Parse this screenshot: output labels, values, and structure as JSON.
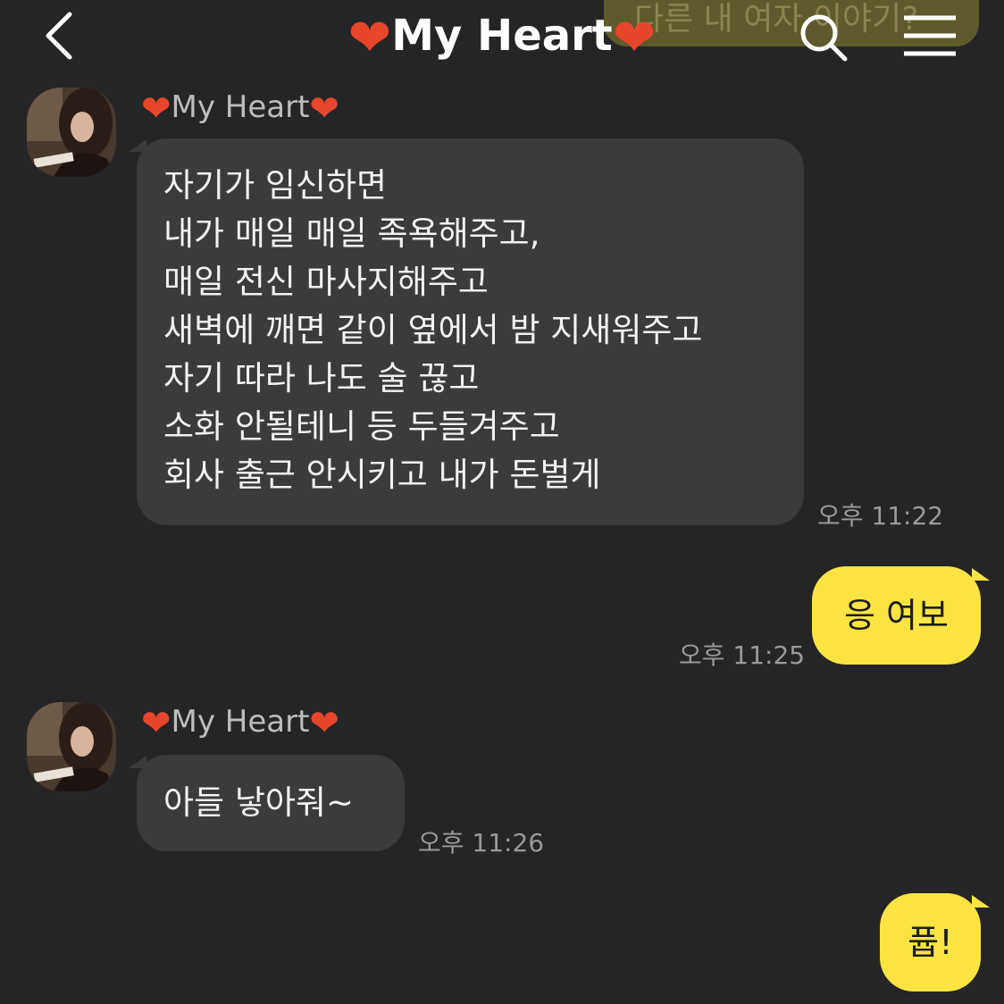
{
  "header": {
    "title": "My Heart",
    "background_bubble_text": "다른 내 여자 이야기?"
  },
  "colors": {
    "background": "#252527",
    "incoming_bubble": "#3b3b3d",
    "outgoing_bubble": "#fde443",
    "heart": "#e8462a"
  },
  "icons": {
    "back": "chevron-left-icon",
    "search": "search-icon",
    "menu": "hamburger-menu-icon",
    "heart": "heart-icon"
  },
  "messages": [
    {
      "direction": "incoming",
      "sender": "My Heart",
      "lines": [
        "자기가 임신하면",
        "내가 매일 매일 족욕해주고,",
        "매일 전신 마사지해주고",
        "새벽에 깨면 같이 옆에서 밤 지새워주고",
        "자기 따라 나도 술 끊고",
        "소화 안될테니 등 두들겨주고",
        "회사 출근 안시키고 내가 돈벌게"
      ],
      "time": "오후 11:22"
    },
    {
      "direction": "outgoing",
      "text": "응 여보",
      "time": "오후 11:25"
    },
    {
      "direction": "incoming",
      "sender": "My Heart",
      "lines": [
        "아들 낳아줘~"
      ],
      "time": "오후 11:26"
    },
    {
      "direction": "outgoing",
      "text": "퓹!"
    }
  ]
}
